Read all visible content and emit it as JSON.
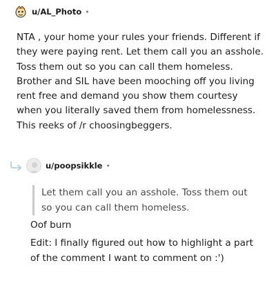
{
  "comment": {
    "username": "u/AL_Photo",
    "separator": "•",
    "avatar_icon": "snoo-avatar-icon",
    "body": "NTA , your home your rules your friends. Different if they were paying rent. Let them call you an asshole. Toss them out so you can call them homeless. Brother and SIL have been mooching off you living rent free and demand you show them courtesy when you literally saved them from homelessness. This reeks of /r choosingbeggers."
  },
  "reply": {
    "reply_icon": "reply-arrow-icon",
    "avatar_icon": "default-avatar-icon",
    "username": "u/poopsikkle",
    "separator": "•",
    "quote": "Let them call you an asshole. Toss them out so you can call them homeless.",
    "paragraph_1": "Oof burn",
    "paragraph_2": "Edit: I finally figured out how to highlight a part of the comment I want to comment on :')"
  }
}
